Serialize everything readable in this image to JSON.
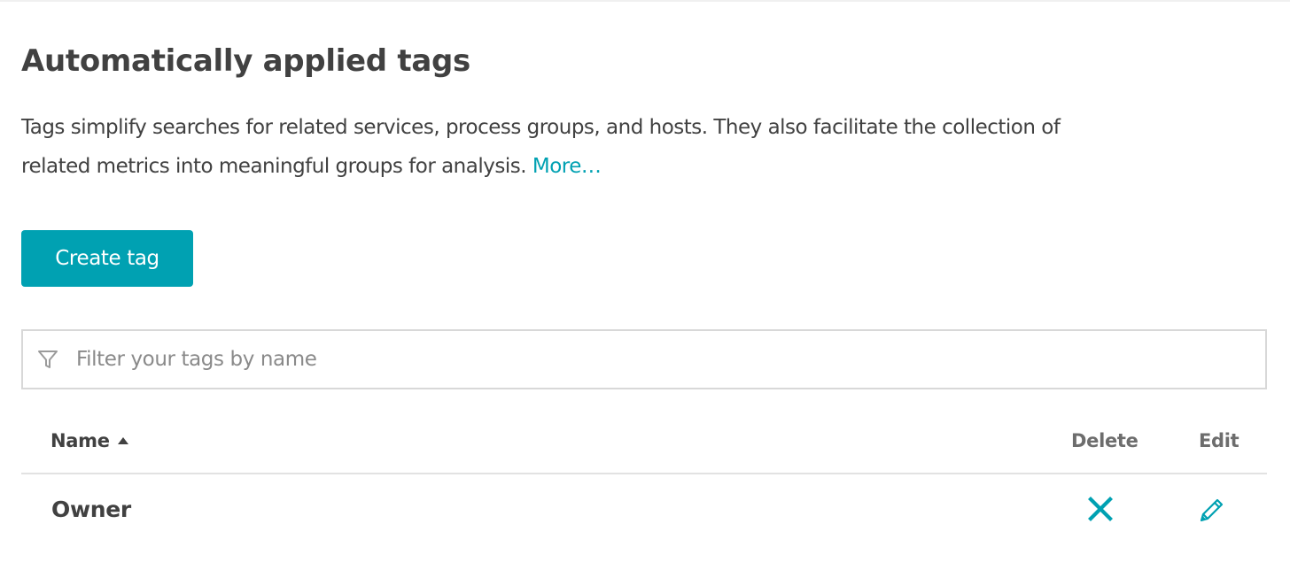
{
  "page": {
    "title": "Automatically applied tags",
    "description": "Tags simplify searches for related services, process groups, and hosts. They also facilitate the collection of related metrics into meaningful groups for analysis.",
    "more_link": "More…"
  },
  "actions": {
    "create_label": "Create tag"
  },
  "filter": {
    "placeholder": "Filter your tags by name",
    "value": "",
    "icon": "filter-icon"
  },
  "table": {
    "columns": {
      "name": "Name",
      "delete": "Delete",
      "edit": "Edit"
    },
    "sort": {
      "column": "name",
      "direction": "ascending"
    },
    "rows": [
      {
        "name": "Owner",
        "delete_icon": "close-icon",
        "edit_icon": "pencil-icon"
      }
    ]
  },
  "colors": {
    "accent": "#00a1b2",
    "text": "#414141",
    "muted_text": "#6d6d6d",
    "border": "#d8d8d8"
  }
}
